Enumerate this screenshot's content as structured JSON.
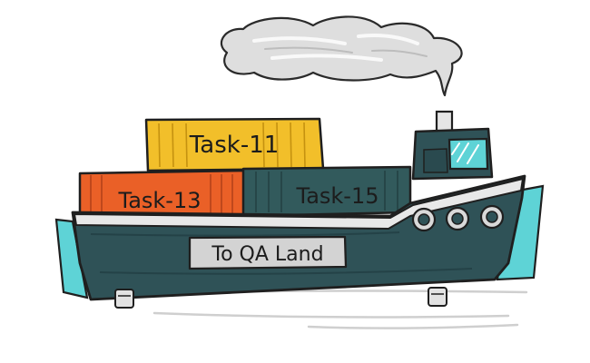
{
  "containers": {
    "top": "Task-11",
    "left": "Task-13",
    "right": "Task-15"
  },
  "hull_sign": "To QA Land",
  "colors": {
    "hull": "#2f5257",
    "hull_dark": "#234246",
    "cyan": "#5ed3d6",
    "container_yellow": "#f2bf2a",
    "container_orange": "#ea6027",
    "container_teal": "#325a5c",
    "cabin": "#2f5257",
    "smoke": "#dcdcdc",
    "outline": "#1f1f1f"
  }
}
